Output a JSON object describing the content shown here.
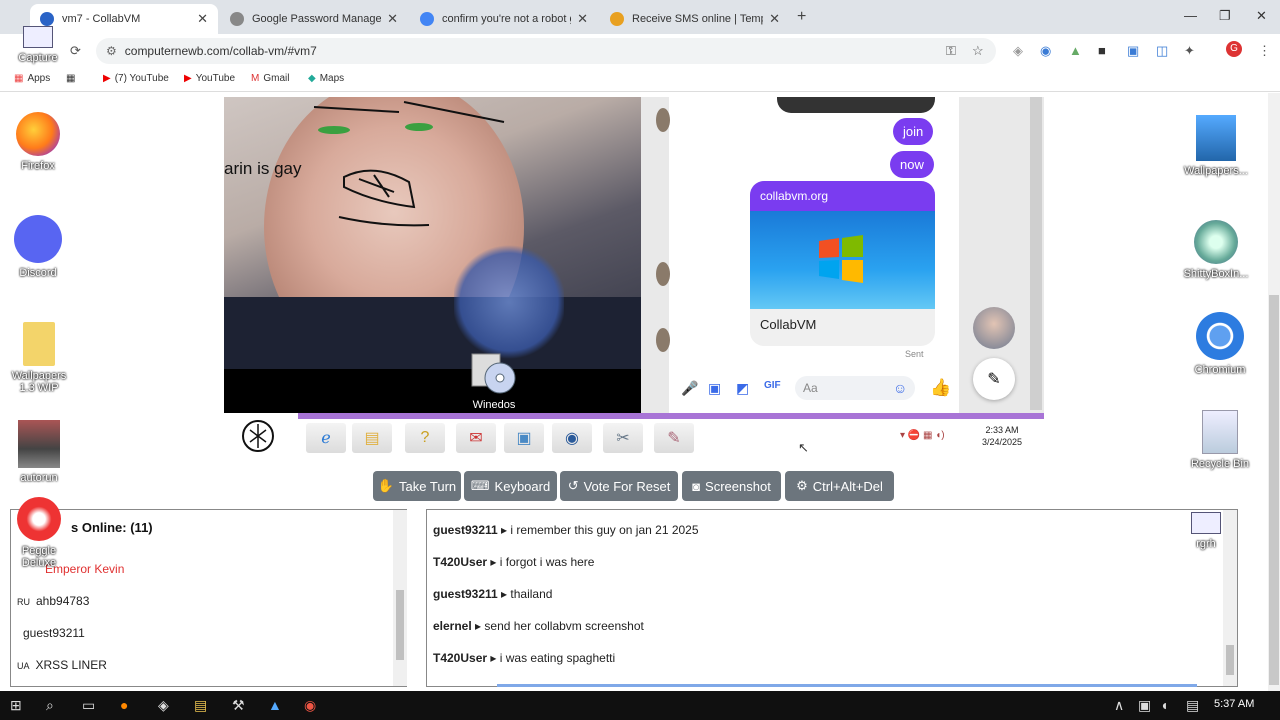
{
  "browser": {
    "tabs": [
      {
        "title": "vm7 - CollabVM",
        "active": true
      },
      {
        "title": "Google Password Manager",
        "active": false
      },
      {
        "title": "confirm you're not a robot goo",
        "active": false
      },
      {
        "title": "Receive SMS online | Temporar",
        "active": false
      }
    ],
    "new_tab_glyph": "+",
    "url": "computernewb.com/collab-vm/#vm7",
    "bookmarks": [
      "Apps",
      "(7) YouTube",
      "YouTube",
      "Gmail",
      "Maps"
    ],
    "profile_initial": "G"
  },
  "desktop_icons": {
    "capture": "Capture",
    "firefox": "Firefox",
    "discord": "Discord",
    "wallpapers_left": "Wallpapers 1.3 WIP",
    "autorun": "autorun",
    "peggle": "Peggle Deluxe",
    "wallpapers_right": "Wallpapers...",
    "shittybox": "ShittyBoxIn...",
    "chromium": "Chromium",
    "recycle": "Recycle Bin",
    "rgrh": "rgrh"
  },
  "vm": {
    "cam_overlay_text": "arin is gay",
    "winedos_label": "Winedos",
    "messenger": {
      "bubbles": [
        "join",
        "now"
      ],
      "link_card_domain": "collabvm.org",
      "link_card_title": "CollabVM",
      "sent_label": "Sent",
      "composer_placeholder": "Aa"
    },
    "clock_time": "2:33 AM",
    "clock_date": "3/24/2025"
  },
  "controls": {
    "take_turn": "Take Turn",
    "keyboard": "Keyboard",
    "vote_reset": "Vote For Reset",
    "screenshot": "Screenshot",
    "ctrl_alt_del": "Ctrl+Alt+Del"
  },
  "users": {
    "header": "s Online: (11)",
    "list": [
      {
        "flag": "",
        "name": "Emperor Kevin",
        "color": "#e03030"
      },
      {
        "flag": "RU",
        "name": "ahb94783",
        "color": "#222222"
      },
      {
        "flag": "",
        "name": "guest93211",
        "color": "#222222"
      },
      {
        "flag": "UA",
        "name": "XRSS LINER",
        "color": "#222222"
      }
    ]
  },
  "chat": [
    {
      "user": "guest93211",
      "text": "i remember this guy on jan 21 2025"
    },
    {
      "user": "T420User",
      "text": "i forgot i was here"
    },
    {
      "user": "guest93211",
      "text": "thailand"
    },
    {
      "user": "elernel",
      "text": "send her collabvm screenshot"
    },
    {
      "user": "T420User",
      "text": "i was eating spaghetti"
    }
  ],
  "taskbar": {
    "time": "5:37 AM"
  },
  "colors": {
    "messenger_purple": "#7a3cf0",
    "button_gray": "#6c757d",
    "accent_blue": "#3b6be8"
  }
}
